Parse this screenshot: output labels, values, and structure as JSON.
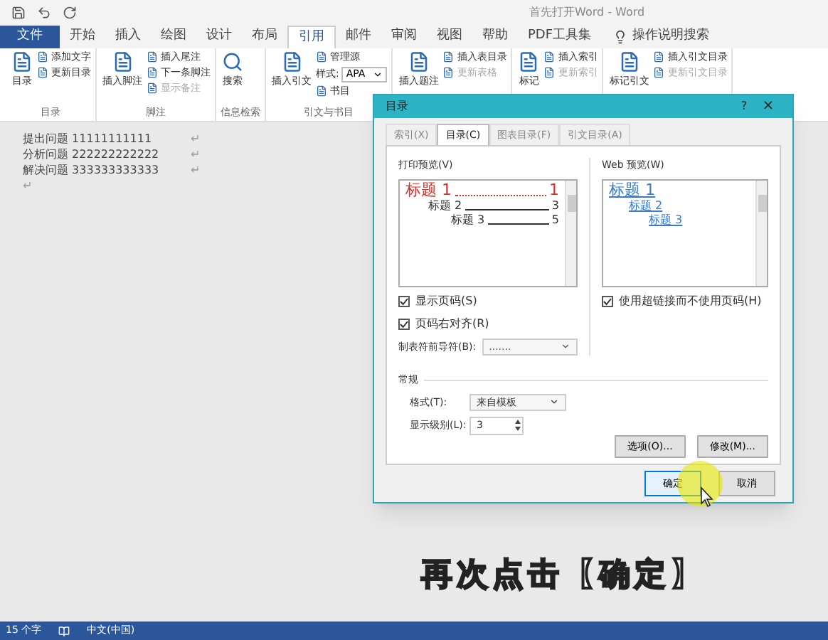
{
  "title_bar": {
    "title": "首先打开Word  -  Word"
  },
  "tabs": [
    {
      "label": "文件",
      "kind": "file",
      "selected": false
    },
    {
      "label": "开始",
      "kind": "tab",
      "selected": false
    },
    {
      "label": "插入",
      "kind": "tab",
      "selected": false
    },
    {
      "label": "绘图",
      "kind": "tab",
      "selected": false
    },
    {
      "label": "设计",
      "kind": "tab",
      "selected": false
    },
    {
      "label": "布局",
      "kind": "tab",
      "selected": false
    },
    {
      "label": "引用",
      "kind": "tab",
      "selected": true
    },
    {
      "label": "邮件",
      "kind": "tab",
      "selected": false
    },
    {
      "label": "审阅",
      "kind": "tab",
      "selected": false
    },
    {
      "label": "视图",
      "kind": "tab",
      "selected": false
    },
    {
      "label": "帮助",
      "kind": "tab",
      "selected": false
    },
    {
      "label": "PDF工具集",
      "kind": "tab",
      "selected": false
    },
    {
      "label": "操作说明搜索",
      "kind": "search",
      "selected": false
    }
  ],
  "ribbon_groups": [
    {
      "label": "目录",
      "items": [
        {
          "label": "目录",
          "kind": "large",
          "disabled": false
        },
        {
          "label": "添加文字",
          "kind": "small",
          "disabled": false
        },
        {
          "label": "更新目录",
          "kind": "small",
          "disabled": false
        }
      ]
    },
    {
      "label": "脚注",
      "items": [
        {
          "label": "插入脚注",
          "kind": "large",
          "disabled": false
        },
        {
          "label": "插入尾注",
          "kind": "small",
          "disabled": false
        },
        {
          "label": "下一条脚注",
          "kind": "small",
          "disabled": false
        },
        {
          "label": "显示备注",
          "kind": "small",
          "disabled": true
        }
      ]
    },
    {
      "label": "信息检索",
      "items": [
        {
          "label": "搜索",
          "kind": "search",
          "disabled": false
        }
      ]
    },
    {
      "label": "引文与书目",
      "items": [
        {
          "label": "插入引文",
          "kind": "large",
          "disabled": false
        },
        {
          "label": "管理源",
          "kind": "small",
          "disabled": false
        },
        {
          "label": "样式:",
          "value": "APA",
          "kind": "select",
          "disabled": false
        },
        {
          "label": "书目",
          "kind": "small",
          "disabled": false
        }
      ]
    },
    {
      "items": [
        {
          "label": "插入题注",
          "kind": "large",
          "disabled": false
        },
        {
          "label": "插入表目录",
          "kind": "small",
          "disabled": false
        },
        {
          "label": "更新表格",
          "kind": "small",
          "disabled": true
        }
      ]
    },
    {
      "items": [
        {
          "label": "标记",
          "kind": "large",
          "disabled": false
        },
        {
          "label": "插入索引",
          "kind": "small",
          "disabled": false
        },
        {
          "label": "更新索引",
          "kind": "small",
          "disabled": true
        }
      ]
    },
    {
      "items": [
        {
          "label": "标记引文",
          "kind": "large",
          "disabled": false
        },
        {
          "label": "插入引文目录",
          "kind": "small",
          "disabled": false
        },
        {
          "label": "更新引文目录",
          "kind": "small",
          "disabled": true
        }
      ]
    }
  ],
  "document": {
    "lines": [
      {
        "text": "提出问题 11111111111",
        "mark": "↵"
      },
      {
        "text": "分析问题 222222222222",
        "mark": "↵"
      },
      {
        "text": "解决问题 333333333333",
        "mark": "↵"
      },
      {
        "mark": "↵"
      }
    ]
  },
  "dialog": {
    "title": "目录",
    "help": "?",
    "close": "×",
    "tabs": [
      {
        "label": "索引(X)",
        "selected": false
      },
      {
        "label": "目录(C)",
        "selected": true
      },
      {
        "label": "图表目录(F)",
        "selected": false
      },
      {
        "label": "引文目录(A)",
        "selected": false
      }
    ],
    "print_preview": {
      "label": "打印预览(V)",
      "entries": [
        {
          "title": "标题 1",
          "page": "1",
          "kind": "h1"
        },
        {
          "title": "标题 2",
          "page": "3",
          "kind": "h2"
        },
        {
          "title": "标题 3",
          "page": "5",
          "kind": "h3"
        }
      ]
    },
    "web_preview": {
      "label": "Web 预览(W)",
      "entries": [
        {
          "title": "标题 1",
          "kind": "h1"
        },
        {
          "title": "标题 2",
          "kind": "h2"
        },
        {
          "title": "标题 3",
          "kind": "h3"
        }
      ]
    },
    "show_page_numbers": {
      "label": "显示页码(S)",
      "checked": true
    },
    "right_align": {
      "label": "页码右对齐(R)",
      "checked": true
    },
    "tab_leader": {
      "label": "制表符前导符(B):",
      "value": "......."
    },
    "use_hyperlinks": {
      "label": "使用超链接而不使用页码(H)",
      "checked": true
    },
    "general": {
      "label": "常规",
      "format": {
        "label": "格式(T):",
        "value": "来自模板"
      },
      "levels": {
        "label": "显示级别(L):",
        "value": "3"
      }
    },
    "buttons": [
      {
        "label": "选项(O)...",
        "kind": "secondary"
      },
      {
        "label": "修改(M)...",
        "kind": "secondary"
      }
    ],
    "footer_buttons": [
      {
        "label": "确定",
        "focused": true
      },
      {
        "label": "取消",
        "focused": false
      }
    ]
  },
  "caption": "再次点击【确定】",
  "status_bar": {
    "word_count": "15 个字",
    "language": "中文(中国)"
  }
}
